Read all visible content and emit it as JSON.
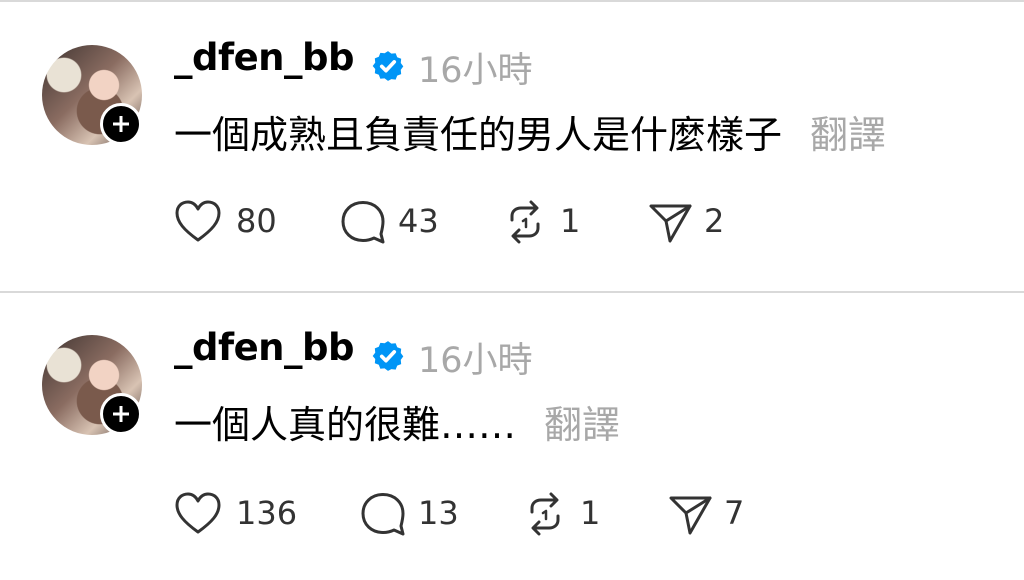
{
  "posts": [
    {
      "username": "_dfen_bb",
      "time": "16小時",
      "text": "一個成熟且負責任的男人是什麼樣子",
      "translate": "翻譯",
      "likes": "80",
      "comments": "43",
      "reposts": "1",
      "shares": "2"
    },
    {
      "username": "_dfen_bb",
      "time": "16小時",
      "text": "一個人真的很難……",
      "translate": "翻譯",
      "likes": "136",
      "comments": "13",
      "reposts": "1",
      "shares": "7"
    }
  ],
  "colors": {
    "verified": "#0095f6",
    "muted": "#a8a8a8",
    "divider": "#d9d9d9"
  },
  "icons": [
    "verified-icon",
    "follow-plus-icon",
    "heart-icon",
    "comment-icon",
    "repost-icon",
    "share-icon"
  ]
}
